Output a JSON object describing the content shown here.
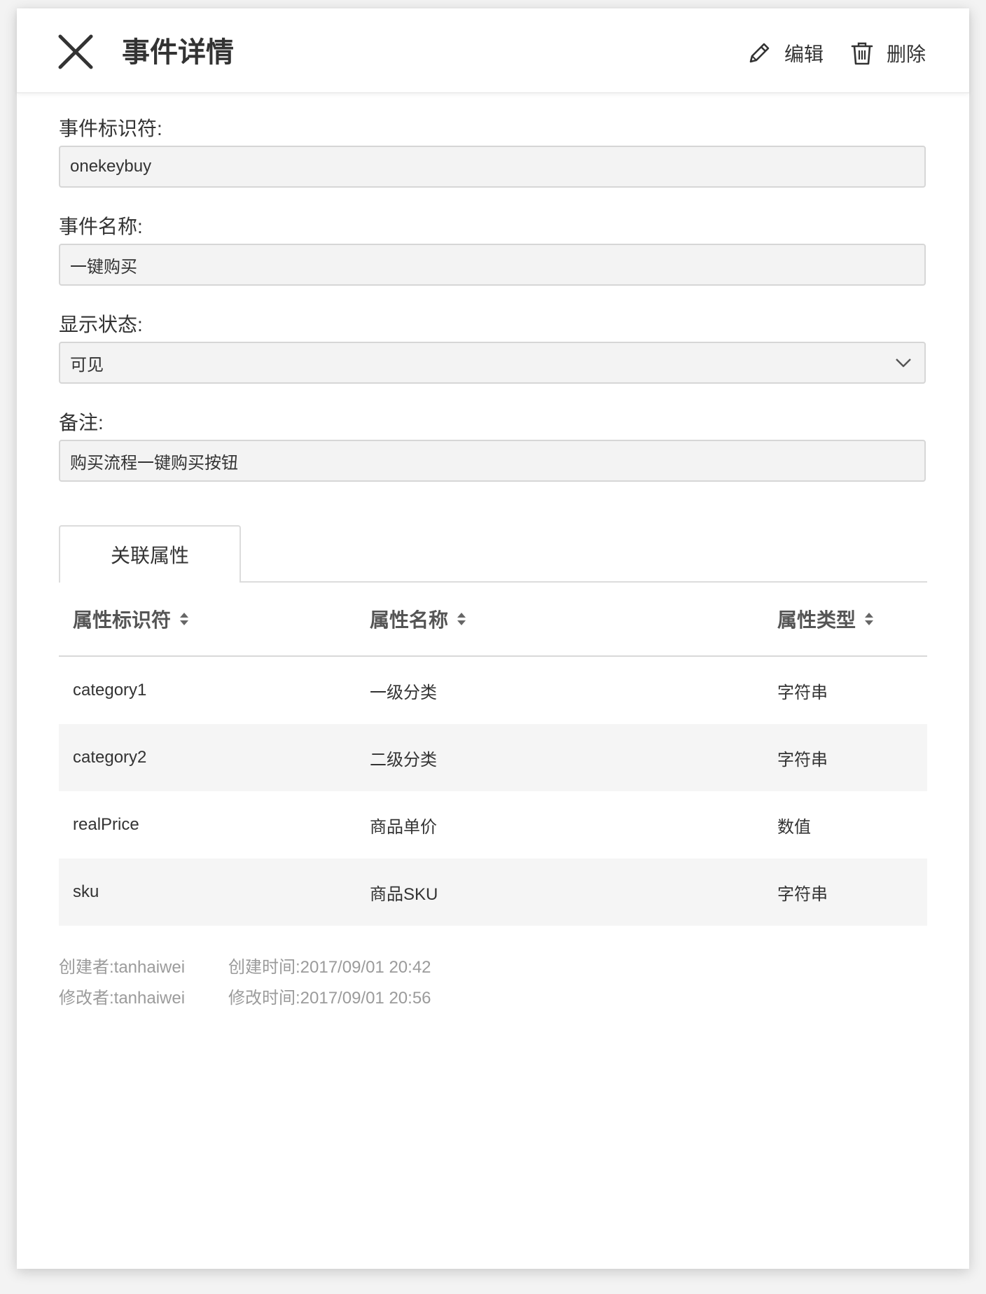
{
  "header": {
    "title": "事件详情",
    "edit_label": "编辑",
    "delete_label": "删除"
  },
  "fields": {
    "identifier_label": "事件标识符:",
    "identifier_value": "onekeybuy",
    "name_label": "事件名称:",
    "name_value": "一键购买",
    "status_label": "显示状态:",
    "status_value": "可见",
    "remark_label": "备注:",
    "remark_value": "购买流程一键购买按钮"
  },
  "tabs": [
    {
      "label": "关联属性",
      "active": true
    }
  ],
  "table": {
    "columns": [
      "属性标识符",
      "属性名称",
      "属性类型"
    ],
    "rows": [
      [
        "category1",
        "一级分类",
        "字符串"
      ],
      [
        "category2",
        "二级分类",
        "字符串"
      ],
      [
        "realPrice",
        "商品单价",
        "数值"
      ],
      [
        "sku",
        "商品SKU",
        "字符串"
      ]
    ]
  },
  "meta": {
    "creator": "创建者:tanhaiwei",
    "created_at": "创建时间:2017/09/01 20:42",
    "modifier": "修改者:tanhaiwei",
    "modified_at": "修改时间:2017/09/01 20:56"
  },
  "icons": {
    "close": "close-icon",
    "edit": "pencil-icon",
    "delete": "trash-icon",
    "select": "chevron-down-icon",
    "sort": "sort-icon"
  },
  "colors": {
    "field_bg": "#f3f3f3",
    "field_border": "#d6d6d6",
    "row_alt": "#f5f5f5",
    "meta_text": "#9b9b9b"
  }
}
